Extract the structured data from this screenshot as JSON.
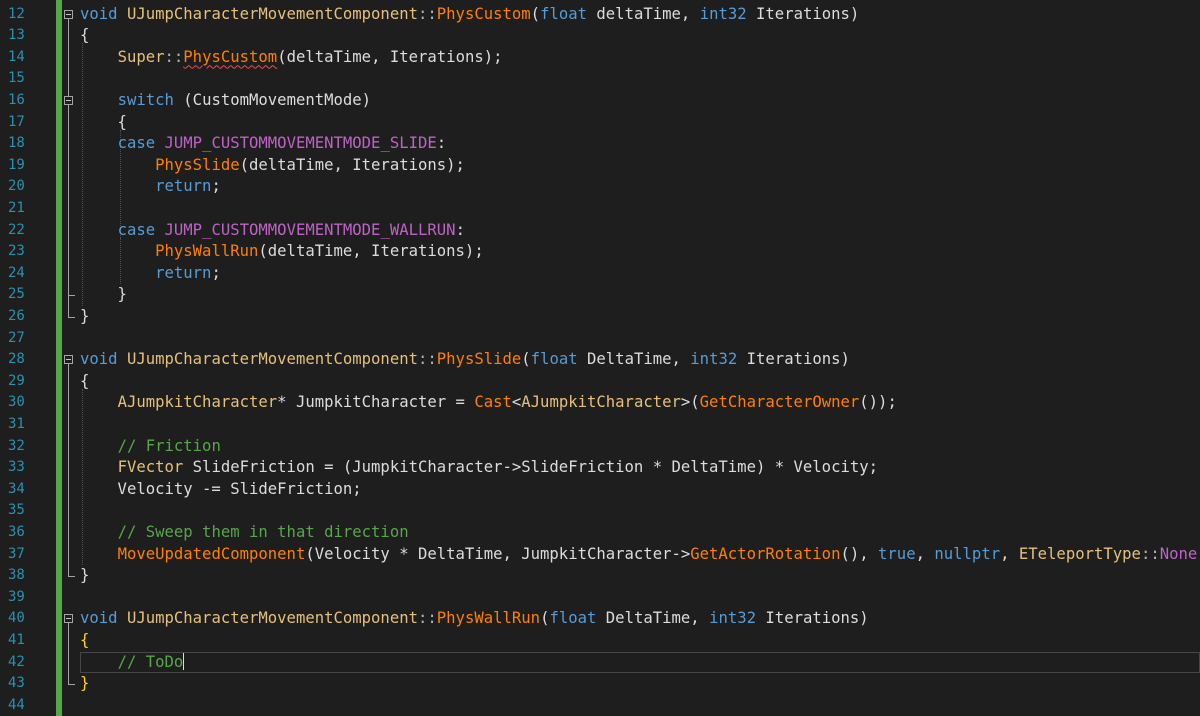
{
  "editor": {
    "line_numbers": [
      "12",
      "13",
      "14",
      "15",
      "16",
      "17",
      "18",
      "19",
      "20",
      "21",
      "22",
      "23",
      "24",
      "25",
      "26",
      "27",
      "28",
      "29",
      "30",
      "31",
      "32",
      "33",
      "34",
      "35",
      "36",
      "37",
      "38",
      "39",
      "40",
      "41",
      "42",
      "43",
      "44"
    ],
    "colors": {
      "background": "#1e1e1e",
      "line_numbers": "#2b91af",
      "change_bar": "#57a64a",
      "keyword": "#569cd6",
      "function": "#ff8000",
      "type": "#e5c07b",
      "macro": "#bd63c5",
      "comment": "#57a64a"
    },
    "lines": [
      [
        [
          "kw",
          "void"
        ],
        [
          "pl",
          " "
        ],
        [
          "tyY",
          "UJumpCharacterMovementComponent"
        ],
        [
          "pu",
          "::"
        ],
        [
          "fnO",
          "PhysCustom"
        ],
        [
          "pl",
          "("
        ],
        [
          "kw",
          "float"
        ],
        [
          "pl",
          " deltaTime, "
        ],
        [
          "kw",
          "int32"
        ],
        [
          "pl",
          " Iterations)"
        ]
      ],
      [
        [
          "pl",
          "{"
        ]
      ],
      [
        [
          "pl",
          "    "
        ],
        [
          "tyY",
          "Super"
        ],
        [
          "pu",
          "::"
        ],
        [
          "fnO sq",
          "PhysCustom"
        ],
        [
          "pl",
          "(deltaTime, Iterations);"
        ]
      ],
      [
        [
          "pl",
          ""
        ]
      ],
      [
        [
          "pl",
          "    "
        ],
        [
          "kw",
          "switch"
        ],
        [
          "pl",
          " (CustomMovementMode)"
        ]
      ],
      [
        [
          "pl",
          "    {"
        ]
      ],
      [
        [
          "pl",
          "    "
        ],
        [
          "kw",
          "case"
        ],
        [
          "pl",
          " "
        ],
        [
          "mac",
          "JUMP_CUSTOMMOVEMENTMODE_SLIDE"
        ],
        [
          "pl",
          ":"
        ]
      ],
      [
        [
          "pl",
          "        "
        ],
        [
          "fnO",
          "PhysSlide"
        ],
        [
          "pl",
          "(deltaTime, Iterations);"
        ]
      ],
      [
        [
          "pl",
          "        "
        ],
        [
          "kw",
          "return"
        ],
        [
          "pl",
          ";"
        ]
      ],
      [
        [
          "pl",
          ""
        ]
      ],
      [
        [
          "pl",
          "    "
        ],
        [
          "kw",
          "case"
        ],
        [
          "pl",
          " "
        ],
        [
          "mac",
          "JUMP_CUSTOMMOVEMENTMODE_WALLRUN"
        ],
        [
          "pl",
          ":"
        ]
      ],
      [
        [
          "pl",
          "        "
        ],
        [
          "fnO",
          "PhysWallRun"
        ],
        [
          "pl",
          "(deltaTime, Iterations);"
        ]
      ],
      [
        [
          "pl",
          "        "
        ],
        [
          "kw",
          "return"
        ],
        [
          "pl",
          ";"
        ]
      ],
      [
        [
          "pl",
          "    }"
        ]
      ],
      [
        [
          "pl",
          "}"
        ]
      ],
      [
        [
          "pl",
          ""
        ]
      ],
      [
        [
          "kw",
          "void"
        ],
        [
          "pl",
          " "
        ],
        [
          "tyY",
          "UJumpCharacterMovementComponent"
        ],
        [
          "pu",
          "::"
        ],
        [
          "fnO",
          "PhysSlide"
        ],
        [
          "pl",
          "("
        ],
        [
          "kw",
          "float"
        ],
        [
          "pl",
          " DeltaTime, "
        ],
        [
          "kw",
          "int32"
        ],
        [
          "pl",
          " Iterations)"
        ]
      ],
      [
        [
          "pl",
          "{"
        ]
      ],
      [
        [
          "pl",
          "    "
        ],
        [
          "tyY",
          "AJumpkitCharacter"
        ],
        [
          "pl",
          "* JumpkitCharacter = "
        ],
        [
          "fnO",
          "Cast"
        ],
        [
          "pl",
          "<"
        ],
        [
          "tyY",
          "AJumpkitCharacter"
        ],
        [
          "pl",
          ">("
        ],
        [
          "fnO",
          "GetCharacterOwner"
        ],
        [
          "pl",
          "());"
        ]
      ],
      [
        [
          "pl",
          ""
        ]
      ],
      [
        [
          "pl",
          "    "
        ],
        [
          "cm",
          "// Friction"
        ]
      ],
      [
        [
          "pl",
          "    "
        ],
        [
          "tyY",
          "FVector"
        ],
        [
          "pl",
          " SlideFriction = (JumpkitCharacter->SlideFriction * DeltaTime) * Velocity;"
        ]
      ],
      [
        [
          "pl",
          "    Velocity -= SlideFriction;"
        ]
      ],
      [
        [
          "pl",
          ""
        ]
      ],
      [
        [
          "pl",
          "    "
        ],
        [
          "cm",
          "// Sweep them in that direction"
        ]
      ],
      [
        [
          "pl",
          "    "
        ],
        [
          "fnO",
          "MoveUpdatedComponent"
        ],
        [
          "pl",
          "(Velocity * DeltaTime, JumpkitCharacter->"
        ],
        [
          "fnO",
          "GetActorRotation"
        ],
        [
          "pl",
          "(), "
        ],
        [
          "kw",
          "true"
        ],
        [
          "pl",
          ", "
        ],
        [
          "kw",
          "nullptr"
        ],
        [
          "pl",
          ", "
        ],
        [
          "tyY",
          "ETeleportType"
        ],
        [
          "pu",
          "::"
        ],
        [
          "mac",
          "None"
        ],
        [
          "pl",
          ");"
        ]
      ],
      [
        [
          "pl",
          "}"
        ]
      ],
      [
        [
          "pl",
          ""
        ]
      ],
      [
        [
          "kw",
          "void"
        ],
        [
          "pl",
          " "
        ],
        [
          "tyY",
          "UJumpCharacterMovementComponent"
        ],
        [
          "pu",
          "::"
        ],
        [
          "fnO",
          "PhysWallRun"
        ],
        [
          "pl",
          "("
        ],
        [
          "kw",
          "float"
        ],
        [
          "pl",
          " DeltaTime, "
        ],
        [
          "kw",
          "int32"
        ],
        [
          "pl",
          " Iterations)"
        ]
      ],
      [
        [
          "br",
          "{"
        ]
      ],
      [
        [
          "pl",
          "    "
        ],
        [
          "cm",
          "// ToDo"
        ],
        [
          "caret",
          ""
        ]
      ],
      [
        [
          "br",
          "}"
        ]
      ],
      [
        [
          "pl",
          ""
        ]
      ]
    ]
  }
}
